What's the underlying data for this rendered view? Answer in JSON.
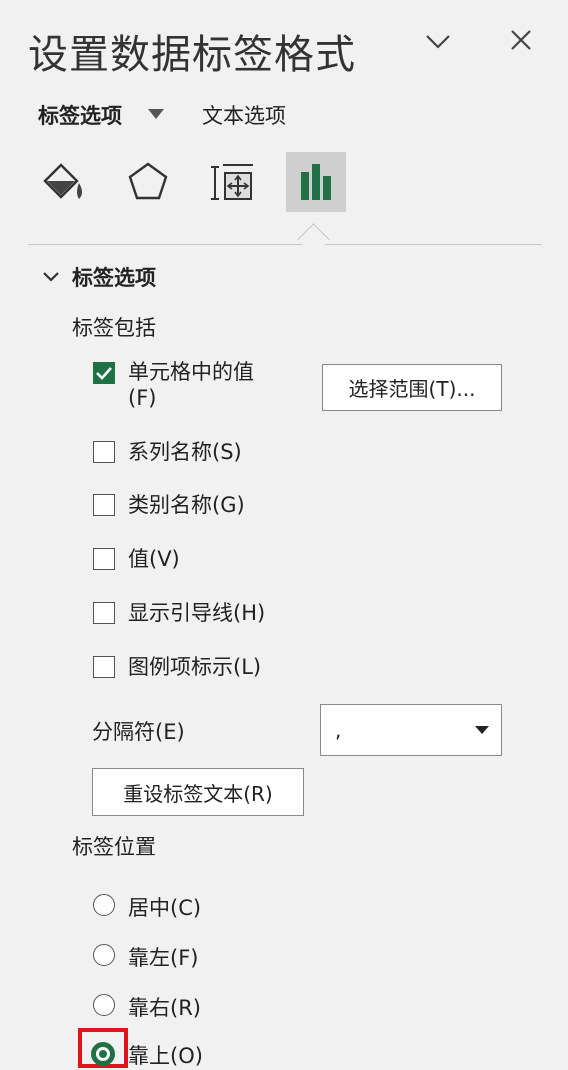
{
  "panel": {
    "title": "设置数据标签格式",
    "collapse_icon": "chevron-down-icon",
    "close_icon": "close-icon"
  },
  "tabs": {
    "label_options": "标签选项",
    "text_options": "文本选项"
  },
  "icon_tabs": [
    "paint-bucket-icon",
    "pentagon-icon",
    "size-properties-icon",
    "bar-chart-icon"
  ],
  "section": {
    "title": "标签选项",
    "includes_label": "标签包括",
    "checkboxes": [
      {
        "label": "单元格中的值",
        "label2": "(F)",
        "checked": true
      },
      {
        "label": "系列名称(S)",
        "checked": false
      },
      {
        "label": "类别名称(G)",
        "checked": false
      },
      {
        "label": "值(V)",
        "checked": false
      },
      {
        "label": "显示引导线(H)",
        "checked": false
      },
      {
        "label": "图例项标示(L)",
        "checked": false
      }
    ],
    "select_range_button": "选择范围(T)...",
    "separator_label": "分隔符(E)",
    "separator_value": ",",
    "reset_button": "重设标签文本(R)",
    "position_label": "标签位置",
    "radios": [
      {
        "label": "居中(C)",
        "selected": false
      },
      {
        "label": "靠左(F)",
        "selected": false
      },
      {
        "label": "靠右(R)",
        "selected": false
      },
      {
        "label": "靠上(O)",
        "selected": true
      }
    ]
  },
  "colors": {
    "accent": "#1f7145",
    "highlight": "#e0141c",
    "background": "#f1f1f1"
  }
}
